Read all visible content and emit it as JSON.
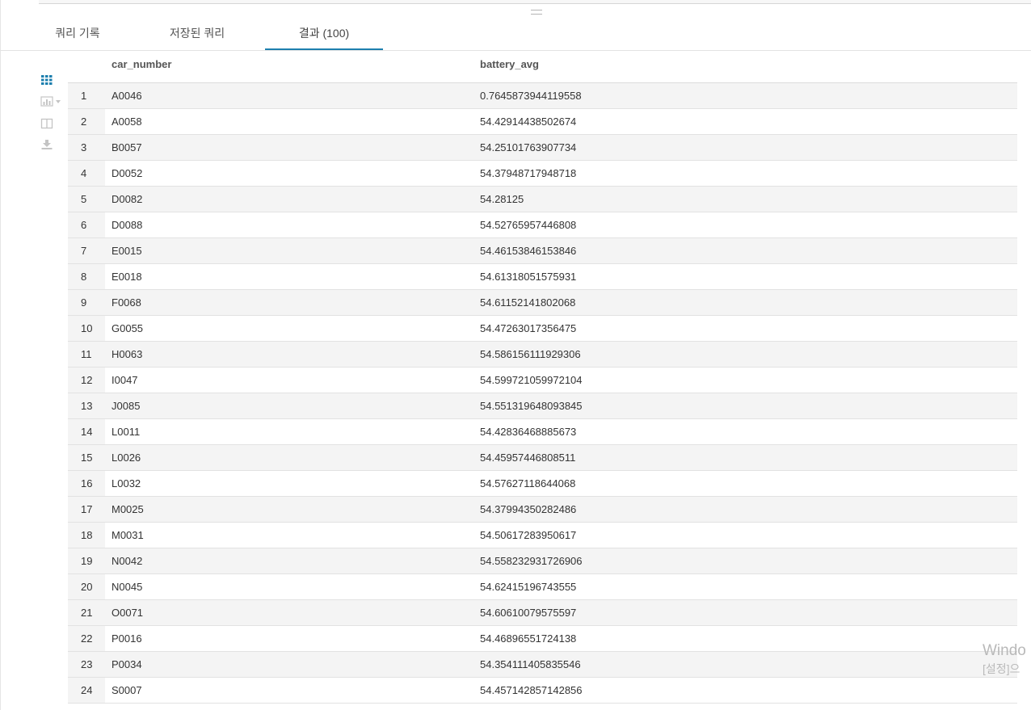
{
  "tabs": [
    {
      "label": "쿼리 기록"
    },
    {
      "label": "저장된 쿼리"
    },
    {
      "label": "결과 (100)"
    }
  ],
  "active_tab": 2,
  "toolbar": {
    "icons": [
      "grid-view-icon",
      "chart-view-icon",
      "column-view-icon",
      "download-icon"
    ],
    "active_color": "#1d7fae",
    "inactive_color": "#c4c4c4"
  },
  "table": {
    "columns": [
      "car_number",
      "battery_avg"
    ],
    "rows": [
      {
        "n": "1",
        "car_number": "A0046",
        "battery_avg": "0.7645873944119558"
      },
      {
        "n": "2",
        "car_number": "A0058",
        "battery_avg": "54.42914438502674"
      },
      {
        "n": "3",
        "car_number": "B0057",
        "battery_avg": "54.25101763907734"
      },
      {
        "n": "4",
        "car_number": "D0052",
        "battery_avg": "54.37948717948718"
      },
      {
        "n": "5",
        "car_number": "D0082",
        "battery_avg": "54.28125"
      },
      {
        "n": "6",
        "car_number": "D0088",
        "battery_avg": "54.52765957446808"
      },
      {
        "n": "7",
        "car_number": "E0015",
        "battery_avg": "54.46153846153846"
      },
      {
        "n": "8",
        "car_number": "E0018",
        "battery_avg": "54.61318051575931"
      },
      {
        "n": "9",
        "car_number": "F0068",
        "battery_avg": "54.61152141802068"
      },
      {
        "n": "10",
        "car_number": "G0055",
        "battery_avg": "54.47263017356475"
      },
      {
        "n": "11",
        "car_number": "H0063",
        "battery_avg": "54.586156111929306"
      },
      {
        "n": "12",
        "car_number": "I0047",
        "battery_avg": "54.599721059972104"
      },
      {
        "n": "13",
        "car_number": "J0085",
        "battery_avg": "54.551319648093845"
      },
      {
        "n": "14",
        "car_number": "L0011",
        "battery_avg": "54.42836468885673"
      },
      {
        "n": "15",
        "car_number": "L0026",
        "battery_avg": "54.45957446808511"
      },
      {
        "n": "16",
        "car_number": "L0032",
        "battery_avg": "54.57627118644068"
      },
      {
        "n": "17",
        "car_number": "M0025",
        "battery_avg": "54.37994350282486"
      },
      {
        "n": "18",
        "car_number": "M0031",
        "battery_avg": "54.50617283950617"
      },
      {
        "n": "19",
        "car_number": "N0042",
        "battery_avg": "54.558232931726906"
      },
      {
        "n": "20",
        "car_number": "N0045",
        "battery_avg": "54.62415196743555"
      },
      {
        "n": "21",
        "car_number": "O0071",
        "battery_avg": "54.60610079575597"
      },
      {
        "n": "22",
        "car_number": "P0016",
        "battery_avg": "54.46896551724138"
      },
      {
        "n": "23",
        "car_number": "P0034",
        "battery_avg": "54.354111405835546"
      },
      {
        "n": "24",
        "car_number": "S0007",
        "battery_avg": "54.457142857142856"
      }
    ]
  },
  "watermark": {
    "line1": "Windo",
    "line2": "[설정]으"
  }
}
